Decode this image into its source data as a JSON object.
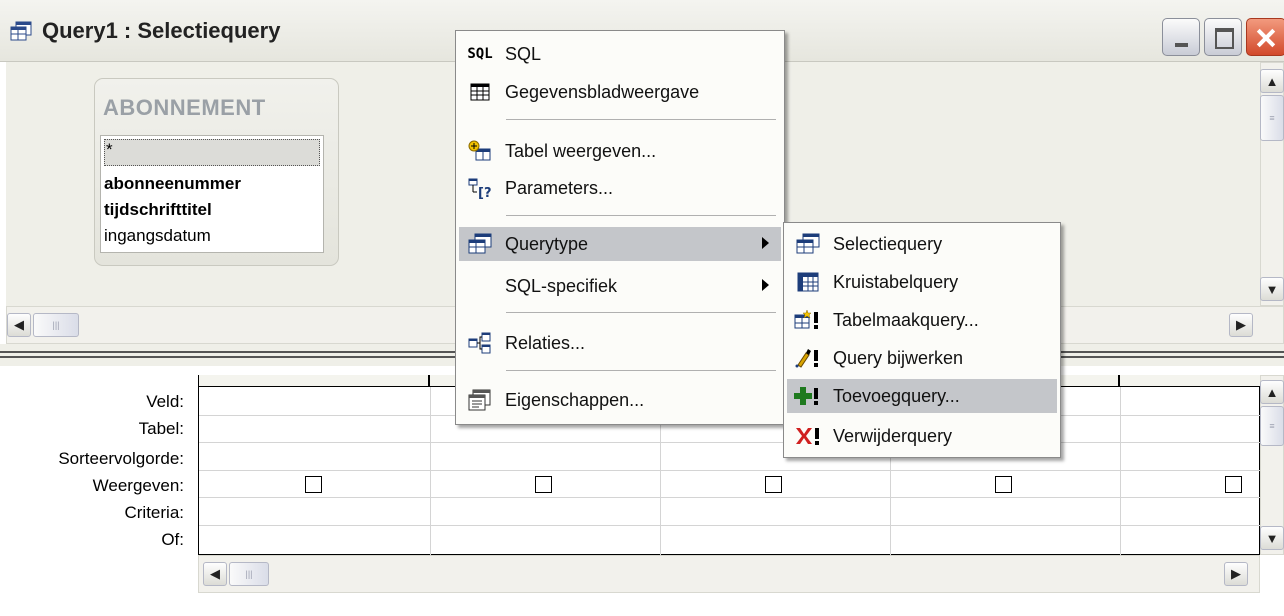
{
  "window": {
    "title": "Query1 : Selectiequery",
    "controls": [
      "minimize",
      "maximize",
      "close"
    ]
  },
  "table_box": {
    "title": "ABONNEMENT",
    "fields": [
      "*",
      "abonneenummer",
      "tijdschrifttitel",
      "ingangsdatum"
    ]
  },
  "design_grid": {
    "row_labels": [
      "Veld:",
      "Tabel:",
      "Sorteervolgorde:",
      "Weergeven:",
      "Criteria:",
      "Of:"
    ]
  },
  "context_menu": {
    "items": [
      {
        "label": "SQL",
        "icon": "SQL",
        "icon_name": "sql-icon"
      },
      {
        "label": "Gegevensbladweergave",
        "icon_name": "datasheet-icon"
      },
      {
        "label": "Tabel weergeven...",
        "icon_name": "show-table-icon"
      },
      {
        "label": "Parameters...",
        "icon_name": "parameters-icon"
      },
      {
        "label": "Querytype",
        "icon_name": "query-type-icon",
        "submenu": true,
        "highlighted": true
      },
      {
        "label": "SQL-specifiek",
        "submenu": true
      },
      {
        "label": "Relaties...",
        "icon_name": "relationships-icon"
      },
      {
        "label": "Eigenschappen...",
        "icon_name": "properties-icon"
      }
    ]
  },
  "query_type_submenu": {
    "items": [
      {
        "label": "Selectiequery",
        "icon_name": "select-query-icon"
      },
      {
        "label": "Kruistabelquery",
        "icon_name": "crosstab-query-icon"
      },
      {
        "label": "Tabelmaakquery...",
        "icon_name": "make-table-query-icon"
      },
      {
        "label": "Query bijwerken",
        "icon_name": "update-query-icon"
      },
      {
        "label": "Toevoegquery...",
        "icon_name": "append-query-icon",
        "highlighted": true
      },
      {
        "label": "Verwijderquery",
        "icon_name": "delete-query-icon"
      }
    ]
  },
  "colors": {
    "menu_highlight": "#c4c6ca",
    "pane_background": "#efefe8",
    "close_button": "#d2492b",
    "delete_icon": "#d02020",
    "append_icon": "#1f7a1f"
  }
}
